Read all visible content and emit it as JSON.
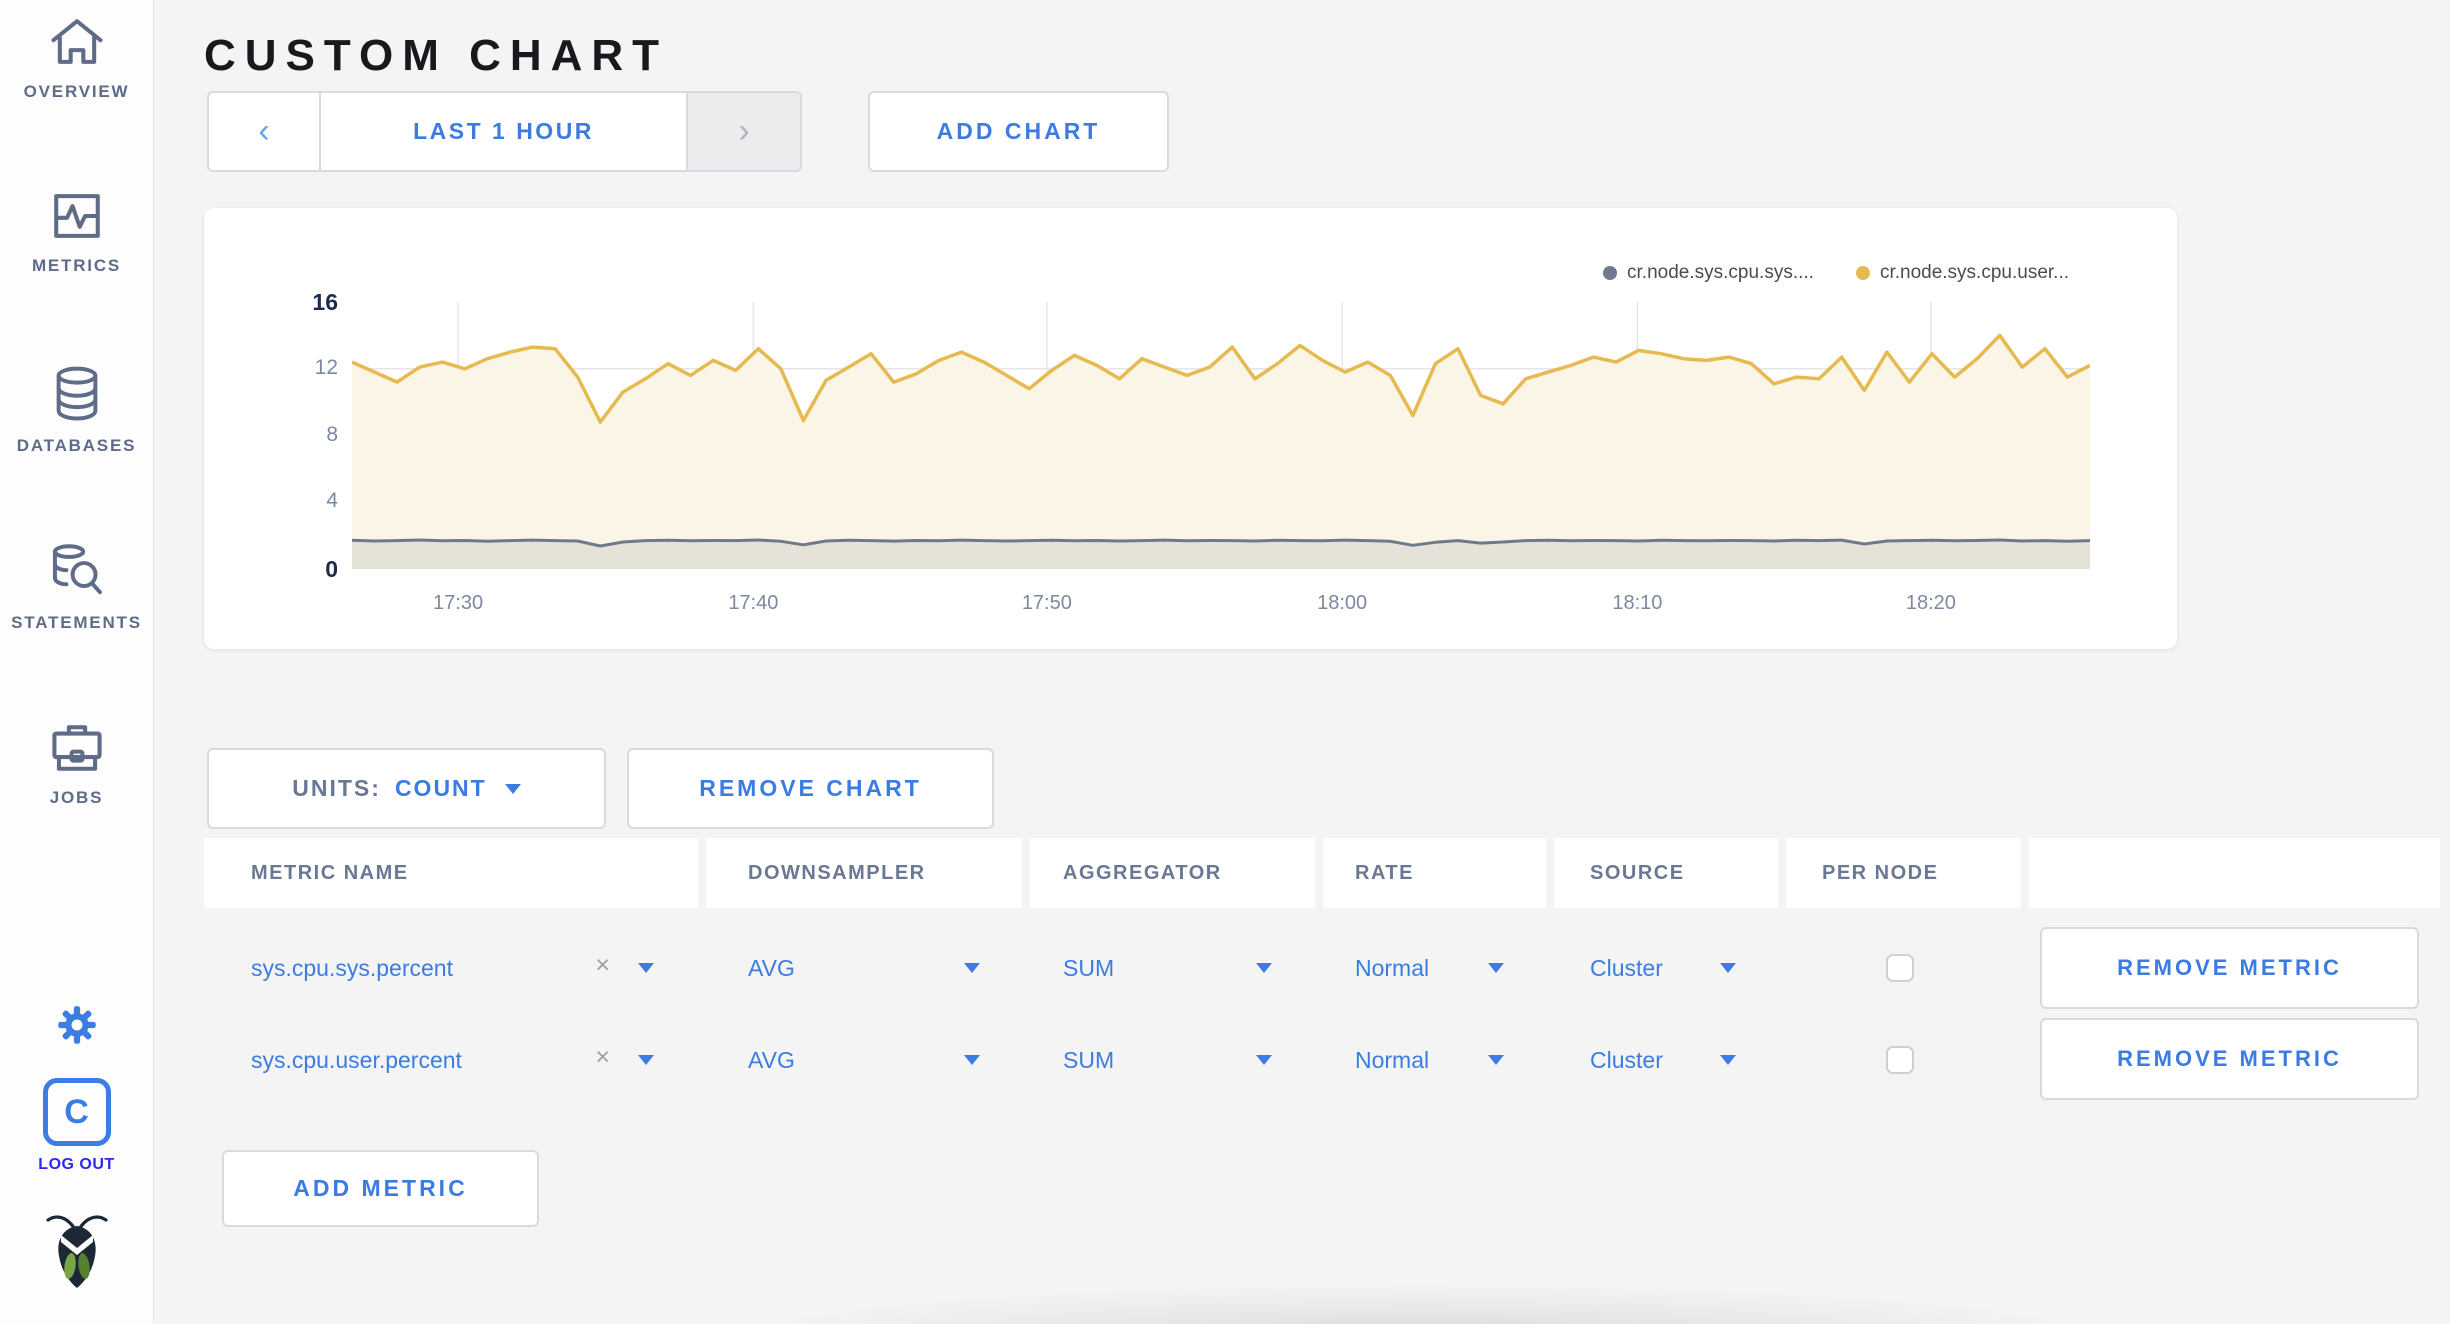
{
  "sidebar": {
    "items": [
      {
        "label": "OVERVIEW"
      },
      {
        "label": "METRICS"
      },
      {
        "label": "DATABASES"
      },
      {
        "label": "STATEMENTS"
      },
      {
        "label": "JOBS"
      }
    ],
    "avatar_letter": "C",
    "logout_label": "LOG OUT"
  },
  "header": {
    "title": "CUSTOM CHART"
  },
  "time_controls": {
    "prev_glyph": "‹",
    "range_label": "LAST 1 HOUR",
    "next_glyph": "›",
    "add_chart_label": "ADD CHART"
  },
  "chart_data": {
    "type": "area",
    "title": "",
    "xlabel": "",
    "ylabel": "",
    "x_range_hours": [
      17.44,
      18.423
    ],
    "x_ticks": [
      {
        "value": 17.5,
        "label": "17:30"
      },
      {
        "value": 17.667,
        "label": "17:40"
      },
      {
        "value": 17.833,
        "label": "17:50"
      },
      {
        "value": 18.0,
        "label": "18:00"
      },
      {
        "value": 18.167,
        "label": "18:10"
      },
      {
        "value": 18.333,
        "label": "18:20"
      }
    ],
    "ylim": [
      0,
      16
    ],
    "y_ticks": [
      0,
      4,
      8,
      12,
      16
    ],
    "grid": true,
    "legend_position": "top-right",
    "series": [
      {
        "name": "cr.node.sys.cpu.sys....",
        "color": "#70798c",
        "fill": "rgba(109,118,138,0.14)",
        "line_width": 3,
        "values": [
          1.72,
          1.68,
          1.7,
          1.74,
          1.69,
          1.71,
          1.66,
          1.7,
          1.73,
          1.7,
          1.68,
          1.38,
          1.62,
          1.7,
          1.72,
          1.69,
          1.71,
          1.7,
          1.74,
          1.66,
          1.45,
          1.68,
          1.72,
          1.7,
          1.67,
          1.71,
          1.69,
          1.73,
          1.7,
          1.68,
          1.7,
          1.72,
          1.69,
          1.71,
          1.68,
          1.7,
          1.73,
          1.69,
          1.71,
          1.7,
          1.68,
          1.72,
          1.7,
          1.69,
          1.73,
          1.7,
          1.66,
          1.42,
          1.6,
          1.7,
          1.55,
          1.62,
          1.7,
          1.72,
          1.69,
          1.71,
          1.7,
          1.68,
          1.72,
          1.7,
          1.69,
          1.71,
          1.7,
          1.68,
          1.72,
          1.7,
          1.73,
          1.5,
          1.68,
          1.7,
          1.72,
          1.69,
          1.71,
          1.74,
          1.68,
          1.7,
          1.66,
          1.7
        ]
      },
      {
        "name": "cr.node.sys.cpu.user...",
        "color": "#e6ba50",
        "fill": "#faf5e6",
        "line_width": 3.5,
        "values": [
          12.4,
          11.8,
          11.2,
          12.1,
          12.4,
          12.0,
          12.6,
          13.0,
          13.3,
          13.2,
          11.5,
          8.8,
          10.6,
          11.4,
          12.3,
          11.6,
          12.5,
          11.9,
          13.2,
          12.0,
          8.9,
          11.3,
          12.1,
          12.9,
          11.2,
          11.7,
          12.5,
          13.0,
          12.4,
          11.6,
          10.8,
          11.9,
          12.8,
          12.2,
          11.4,
          12.6,
          12.1,
          11.6,
          12.1,
          13.3,
          11.4,
          12.3,
          13.4,
          12.5,
          11.8,
          12.4,
          11.6,
          9.2,
          12.3,
          13.2,
          10.4,
          9.9,
          11.4,
          11.8,
          12.2,
          12.7,
          12.4,
          13.1,
          12.9,
          12.6,
          12.5,
          12.7,
          12.3,
          11.1,
          11.5,
          11.4,
          12.7,
          10.7,
          13.0,
          11.2,
          12.9,
          11.5,
          12.6,
          14.0,
          12.1,
          13.2,
          11.5,
          12.2
        ]
      }
    ]
  },
  "chart_controls": {
    "units_prefix": "UNITS:",
    "units_value": "COUNT",
    "remove_chart_label": "REMOVE CHART",
    "add_metric_label": "ADD METRIC"
  },
  "metrics_table": {
    "columns": [
      "METRIC NAME",
      "DOWNSAMPLER",
      "AGGREGATOR",
      "RATE",
      "SOURCE",
      "PER NODE",
      ""
    ],
    "clear_glyph": "×",
    "rows": [
      {
        "metric": "sys.cpu.sys.percent",
        "downsampler": "AVG",
        "aggregator": "SUM",
        "rate": "Normal",
        "source": "Cluster",
        "per_node_checked": false,
        "remove_label": "REMOVE METRIC"
      },
      {
        "metric": "sys.cpu.user.percent",
        "downsampler": "AVG",
        "aggregator": "SUM",
        "rate": "Normal",
        "source": "Cluster",
        "per_node_checked": false,
        "remove_label": "REMOVE METRIC"
      }
    ]
  }
}
